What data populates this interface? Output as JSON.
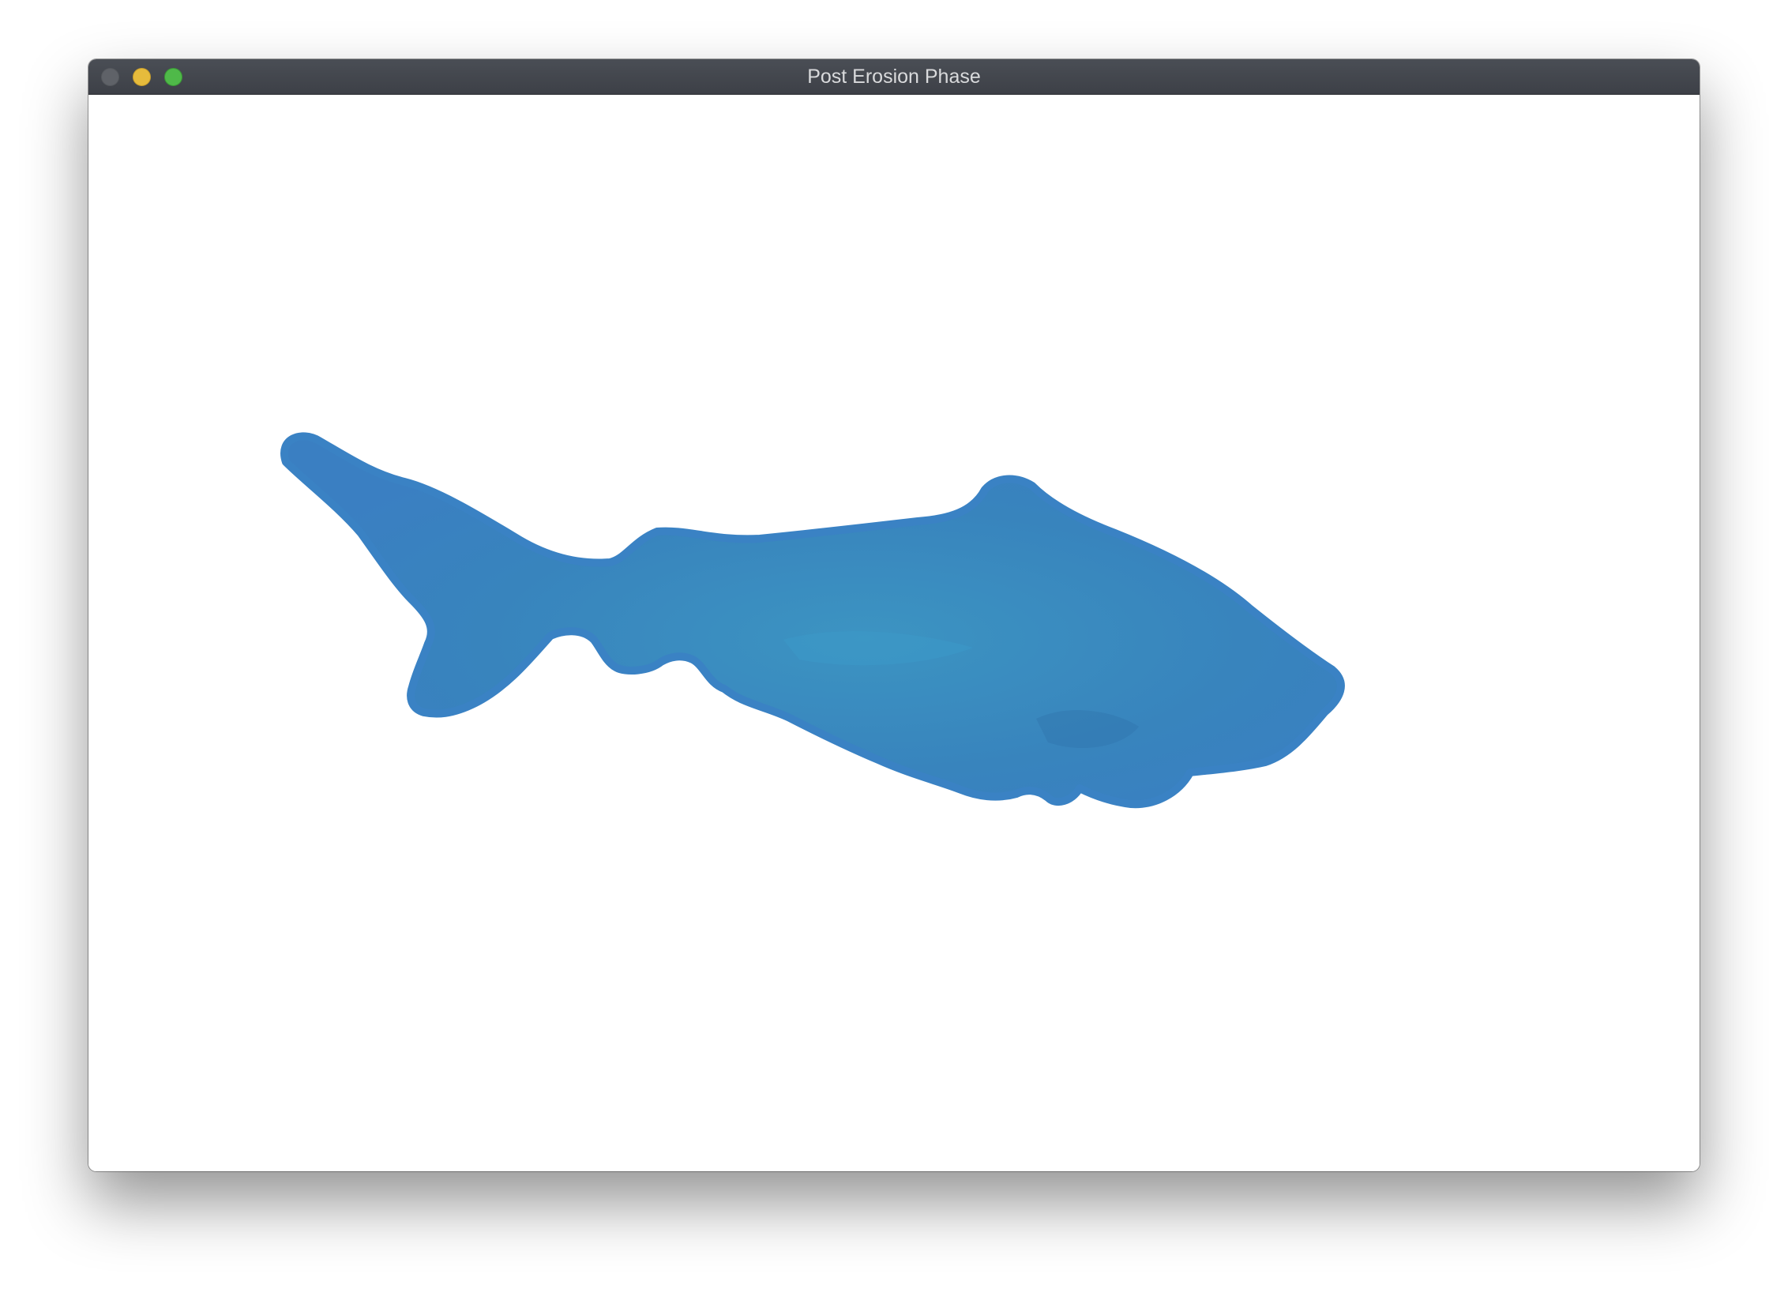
{
  "window": {
    "title": "Post Erosion Phase",
    "controls": {
      "close_color": "#5f6268",
      "minimize_color": "#e6bb3c",
      "zoom_color": "#4fb949"
    }
  },
  "canvas": {
    "background": "#ffffff",
    "shape": "fish-silhouette",
    "shape_color": "#3a82c4",
    "shape_inner_color": "#3b8fbf"
  }
}
